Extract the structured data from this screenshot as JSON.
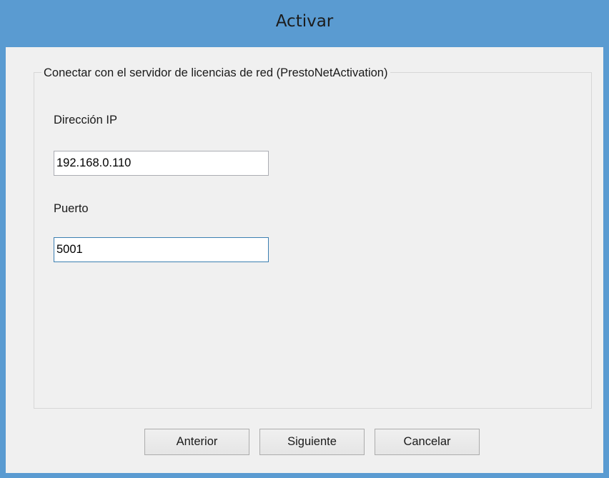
{
  "window": {
    "title": "Activar"
  },
  "group": {
    "title": "Conectar con el servidor de licencias de red (PrestoNetActivation)"
  },
  "ip_field": {
    "label": "Dirección IP",
    "value": "192.168.0.110"
  },
  "port_field": {
    "label": "Puerto",
    "value": "5001"
  },
  "buttons": {
    "back": "Anterior",
    "next": "Siguiente",
    "cancel": "Cancelar"
  },
  "colors": {
    "titlebar": "#5a9bd1",
    "dialog_background": "#f0f0f0",
    "focused_border": "#3c7fb1"
  }
}
